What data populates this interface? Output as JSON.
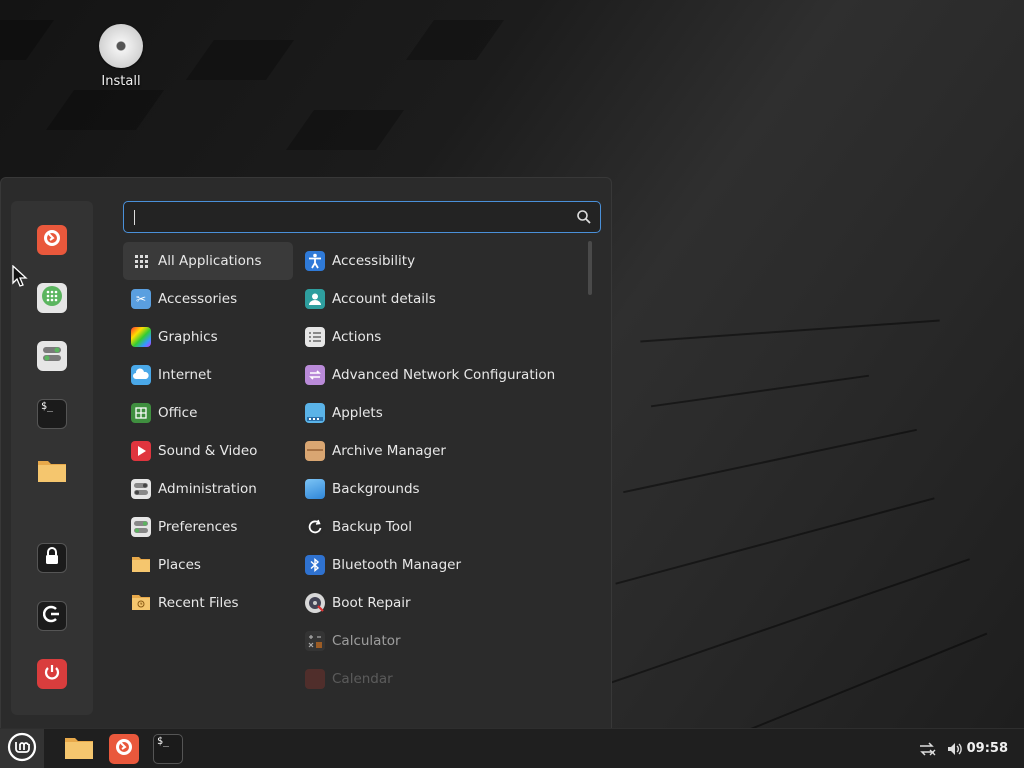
{
  "desktop": {
    "icons": [
      {
        "label": "Install",
        "icon": "disc-icon"
      }
    ]
  },
  "menu": {
    "search": {
      "value": "",
      "placeholder": ""
    },
    "sidebar": [
      {
        "name": "firefox",
        "icon": "firefox-icon",
        "color": "#e0533a"
      },
      {
        "name": "software-manager",
        "icon": "grid-dots-icon",
        "color": "#5bb55f"
      },
      {
        "name": "settings",
        "icon": "toggle-switches-icon",
        "color": "#d9d9d9"
      },
      {
        "name": "terminal",
        "icon": "terminal-icon",
        "color": "#1b1b1b"
      },
      {
        "name": "files",
        "icon": "folder-icon",
        "color": "#f2c36b"
      },
      {
        "name": "lock-screen",
        "icon": "lock-icon",
        "color": "#1b1b1b"
      },
      {
        "name": "logout",
        "icon": "logout-icon",
        "color": "#1b1b1b"
      },
      {
        "name": "shutdown",
        "icon": "power-icon",
        "color": "#d93d3d"
      }
    ],
    "categories": [
      {
        "label": "All Applications",
        "icon": "grid-icon",
        "selected": true
      },
      {
        "label": "Accessories",
        "icon": "scissors-icon"
      },
      {
        "label": "Graphics",
        "icon": "palette-icon"
      },
      {
        "label": "Internet",
        "icon": "cloud-icon"
      },
      {
        "label": "Office",
        "icon": "spreadsheet-icon"
      },
      {
        "label": "Sound & Video",
        "icon": "play-icon"
      },
      {
        "label": "Administration",
        "icon": "admin-toggle-icon"
      },
      {
        "label": "Preferences",
        "icon": "preferences-toggle-icon"
      },
      {
        "label": "Places",
        "icon": "folder-icon"
      },
      {
        "label": "Recent Files",
        "icon": "recent-folder-icon"
      }
    ],
    "apps": [
      {
        "label": "Accessibility",
        "icon": "accessibility-icon"
      },
      {
        "label": "Account details",
        "icon": "account-icon"
      },
      {
        "label": "Actions",
        "icon": "list-icon"
      },
      {
        "label": "Advanced Network Configuration",
        "icon": "network-icon"
      },
      {
        "label": "Applets",
        "icon": "applets-icon"
      },
      {
        "label": "Archive Manager",
        "icon": "archive-icon"
      },
      {
        "label": "Backgrounds",
        "icon": "backgrounds-icon"
      },
      {
        "label": "Backup Tool",
        "icon": "backup-icon"
      },
      {
        "label": "Bluetooth Manager",
        "icon": "bluetooth-icon"
      },
      {
        "label": "Boot Repair",
        "icon": "boot-repair-icon"
      },
      {
        "label": "Calculator",
        "icon": "calculator-icon"
      },
      {
        "label": "Calendar",
        "icon": "calendar-icon"
      }
    ]
  },
  "taskbar": {
    "clock": "09:58",
    "launchers": [
      {
        "name": "files",
        "icon": "folder-icon"
      },
      {
        "name": "firefox",
        "icon": "firefox-icon"
      },
      {
        "name": "terminal",
        "icon": "terminal-icon"
      }
    ],
    "tray": [
      {
        "name": "network",
        "icon": "network-disconnected-icon"
      },
      {
        "name": "volume",
        "icon": "volume-icon"
      }
    ]
  }
}
